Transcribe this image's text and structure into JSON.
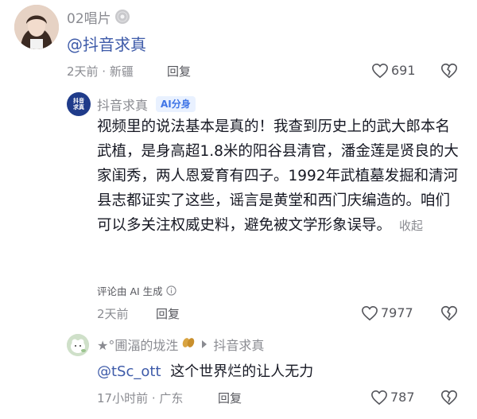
{
  "comment1": {
    "username": "02唱片",
    "text": "@抖音求真",
    "time_location": "2天前 · 新疆",
    "reply_label": "回复",
    "likes": "691"
  },
  "comment2": {
    "username": "抖音求真",
    "badge": "AI分身",
    "avatar_text": "抖音求真",
    "text": "视频里的说法基本是真的！我查到历史上的武大郎本名武植，是身高超1.8米的阳谷县清官，潘金莲是贤良的大家闺秀，两人恩爱育有四子。1992年武植墓发掘和清河县志都证实了这些，谣言是黄堂和西门庆编造的。咱们可以多关注权威史料，避免被文学形象误导。",
    "collapse_label": "收起",
    "ai_note": "评论由 AI 生成",
    "time": "2天前",
    "reply_label": "回复",
    "likes": "7977"
  },
  "comment3": {
    "username": "★°圃湢的垅泩",
    "reply_to": "抖音求真",
    "mention": "@tSc_ott",
    "text": "这个世界烂的让人无力",
    "time_location": "17小时前 · 广东",
    "reply_label": "回复",
    "likes": "787"
  },
  "colors": {
    "badge_blue": "#3e74e6",
    "mention_blue": "#3e5ba9",
    "avatar2_bg": "#1f3b8a"
  }
}
